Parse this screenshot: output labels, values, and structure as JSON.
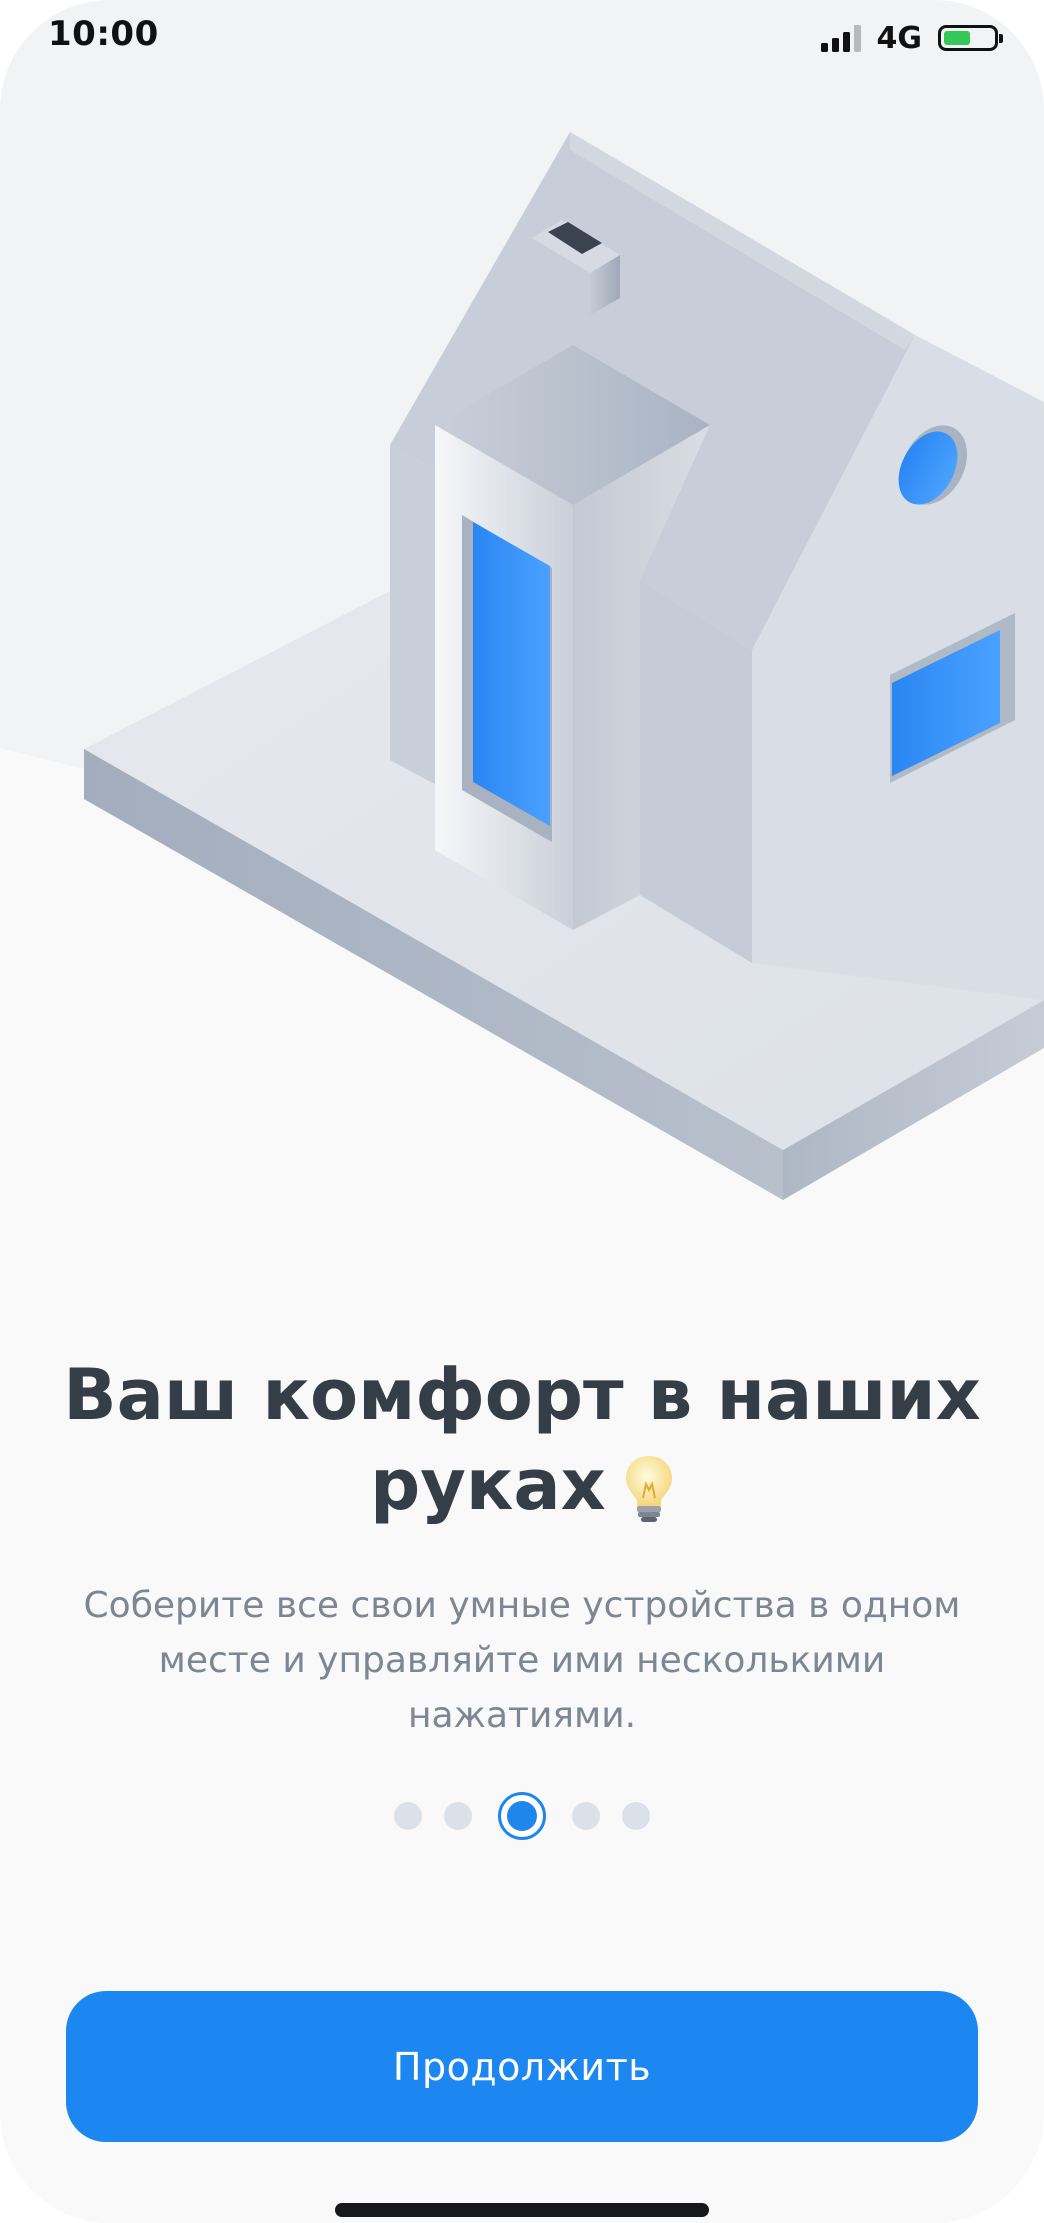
{
  "status_bar": {
    "time": "10:00",
    "network": "4G",
    "signal_bars_active": 3,
    "signal_bars_total": 4,
    "battery_level": 0.55,
    "battery_color": "#34c759"
  },
  "illustration": {
    "subject": "house-illustration",
    "window_color": "#2a88f4"
  },
  "onboarding": {
    "title_line1": "Ваш комфорт в наших",
    "title_line2": "руках",
    "title_icon": "lightbulb-icon",
    "description": "Соберите все свои умные устройства в одном месте и управляйте ими несколькими нажатиями.",
    "pagination": {
      "total": 5,
      "current": 3
    }
  },
  "actions": {
    "continue_label": "Продолжить",
    "accent_color": "#1c87f0"
  }
}
